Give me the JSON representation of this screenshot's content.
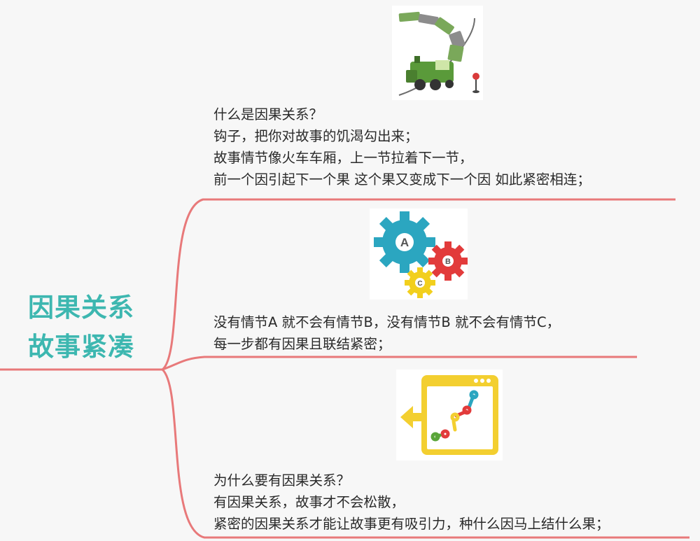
{
  "central_topic": {
    "line1": "因果关系",
    "line2": "故事紧凑"
  },
  "branches": [
    {
      "image": "train-icon",
      "lines": [
        "什么是因果关系？",
        "钩子，把你对故事的饥渴勾出来；",
        "故事情节像火车车厢，上一节拉着下一节，",
        "前一个因引起下一个果 这个果又变成下一个因 如此紧密相连；"
      ]
    },
    {
      "image": "gears-icon",
      "gear_labels": [
        "A",
        "B",
        "C"
      ],
      "lines": [
        "没有情节A 就不会有情节B，没有情节B 就不会有情节C，",
        "每一步都有因果且联结紧密；"
      ]
    },
    {
      "image": "browser-chain-icon",
      "lines": [
        "为什么要有因果关系？",
        "有因果关系，故事才不会松散，",
        "紧密的因果关系才能让故事更有吸引力，种什么因马上结什么果；"
      ]
    }
  ],
  "colors": {
    "branch_line": "#e8797a",
    "central_text": "#3db7b0",
    "gear_a": "#2ba6c0",
    "gear_b": "#e23b3b",
    "gear_c": "#f2cf1d",
    "train": "#5a9a3a"
  }
}
